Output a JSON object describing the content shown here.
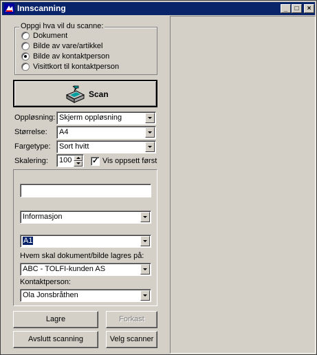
{
  "window": {
    "title": "Innscanning"
  },
  "titlebar_buttons": {
    "min": "_",
    "max": "□",
    "close": "×"
  },
  "scan_type": {
    "legend": "Oppgi hva vil du scanne:",
    "options": [
      {
        "label": "Dokument",
        "checked": false
      },
      {
        "label": "Bilde av vare/artikkel",
        "checked": false
      },
      {
        "label": "Bilde av kontaktperson",
        "checked": true
      },
      {
        "label": "Visittkort til kontaktperson",
        "checked": false
      }
    ]
  },
  "scan_button": {
    "label": "Scan",
    "icon": "scanner-icon"
  },
  "settings": {
    "resolution_label": "Oppløsning:",
    "resolution_value": "Skjerm oppløsning",
    "size_label": "Størrelse:",
    "size_value": "A4",
    "color_label": "Fargetype:",
    "color_value": "Sort hvitt",
    "scale_label": "Skalering:",
    "scale_value": "100",
    "preview_label": "Vis oppsett først",
    "preview_checked": true
  },
  "details": {
    "name_value": "",
    "category_value": "Informasjon",
    "code_value": "A1",
    "save_location_label": "Hvem skal dokument/bilde lagres på:",
    "company_value": "ABC - TOLFI-kunden AS",
    "contact_label": "Kontaktperson:",
    "contact_value": "Ola Jonsbråthen"
  },
  "buttons": {
    "save": "Lagre",
    "discard": "Forkast",
    "finish": "Avslutt scanning",
    "choose_scanner": "Velg scanner"
  }
}
